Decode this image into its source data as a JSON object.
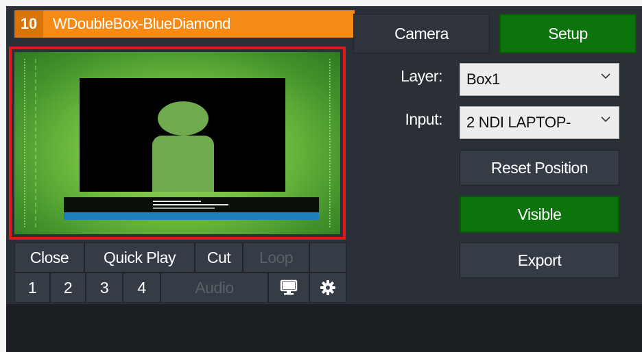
{
  "input": {
    "number": "10",
    "title": "WDoubleBox-BlueDiamond"
  },
  "controls": {
    "close": "Close",
    "quick_play": "Quick Play",
    "cut": "Cut",
    "loop": "Loop",
    "buttons": [
      "1",
      "2",
      "3",
      "4"
    ],
    "audio": "Audio"
  },
  "tabs": {
    "camera": "Camera",
    "setup": "Setup"
  },
  "setup": {
    "layer_label": "Layer:",
    "layer_value": "Box1",
    "input_label": "Input:",
    "input_value": "2 NDI LAPTOP-",
    "reset_position": "Reset Position",
    "visible": "Visible",
    "export": "Export"
  },
  "icons": {
    "monitor": "monitor-icon",
    "settings": "gear-icon"
  },
  "colors": {
    "title_bar": "#f58a14",
    "active_green": "#0d730d",
    "selection_outline": "#e01a1a"
  }
}
